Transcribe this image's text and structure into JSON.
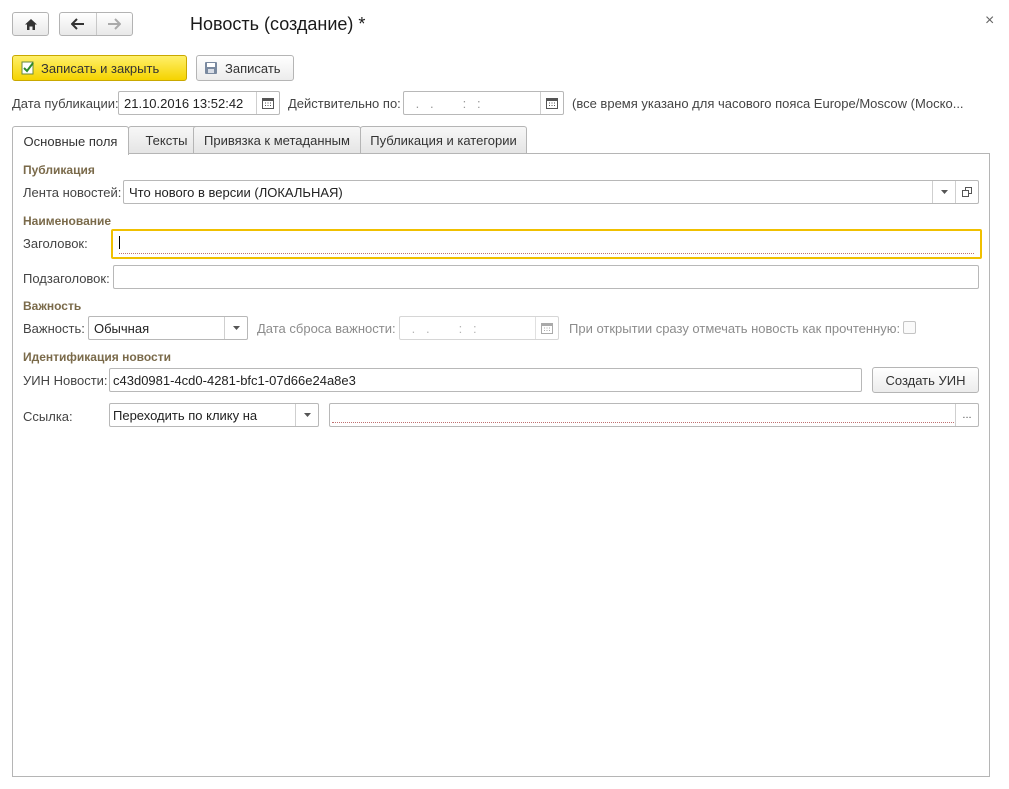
{
  "window": {
    "title": "Новость (создание) *",
    "close_glyph": "×"
  },
  "toolbar": {
    "save_close_label": "Записать и закрыть",
    "save_label": "Записать"
  },
  "dates": {
    "publish_label": "Дата публикации:",
    "publish_value": "21.10.2016 13:52:42",
    "valid_label": "Действительно по:",
    "valid_placeholder": " .   .        :   :",
    "timezone_note": "(все время указано для часового пояса Europe/Moscow (Моско..."
  },
  "tabs": [
    {
      "label": "Основные поля"
    },
    {
      "label": "Тексты"
    },
    {
      "label": "Привязка к метаданным"
    },
    {
      "label": "Публикация и категории"
    }
  ],
  "sections": {
    "publication": "Публикация",
    "naming": "Наименование",
    "importance": "Важность",
    "identification": "Идентификация новости"
  },
  "form": {
    "feed_label": "Лента новостей:",
    "feed_value": "Что нового в версии (ЛОКАЛЬНАЯ)",
    "heading_label": "Заголовок:",
    "heading_value": "",
    "subheading_label": "Подзаголовок:",
    "subheading_value": "",
    "importance_label": "Важность:",
    "importance_value": "Обычная",
    "reset_date_label": "Дата сброса важности:",
    "reset_date_placeholder": " .   .        :   :",
    "mark_read_label": "При открытии сразу отмечать новость как прочтенную:",
    "uin_label": "УИН Новости:",
    "uin_value": "c43d0981-4cd0-4281-bfc1-07d66e24a8e3",
    "create_uin_label": "Создать УИН",
    "link_label": "Ссылка:",
    "link_mode_value": "Переходить по клику на",
    "link_value": "",
    "ellipsis": "..."
  },
  "colors": {
    "accent_yellow": "#f5d300",
    "focus_border": "#f0c000",
    "section_heading": "#7a6a4a"
  },
  "icons": [
    "home-icon",
    "back-arrow-icon",
    "forward-arrow-icon",
    "close-icon",
    "save-close-icon",
    "save-disk-icon",
    "calendar-icon",
    "dropdown-icon",
    "open-form-icon"
  ]
}
